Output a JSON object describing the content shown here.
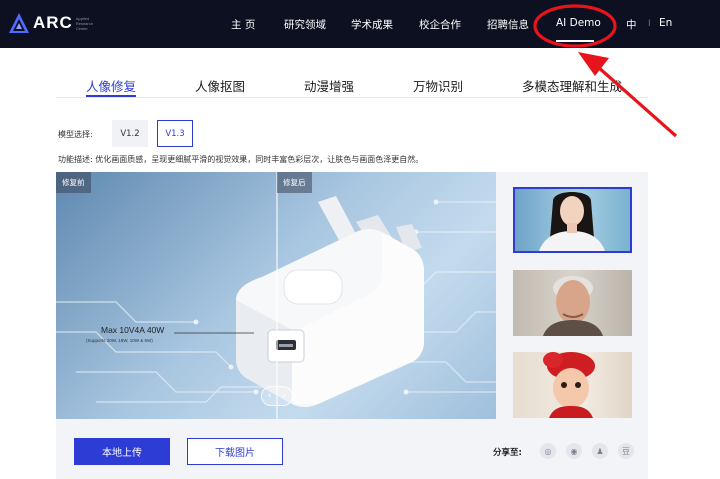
{
  "brand": {
    "name": "ARC",
    "sub": "Applied Research Center"
  },
  "nav": {
    "items": [
      "主 页",
      "研究领域",
      "学术成果",
      "校企合作",
      "招聘信息",
      "AI Demo"
    ],
    "lang_zh": "中",
    "lang_sep": "I",
    "lang_en": "En"
  },
  "tabs": [
    "人像修复",
    "人像抠图",
    "动漫增强",
    "万物识别",
    "多模态理解和生成"
  ],
  "model": {
    "label": "模型选择:",
    "options": [
      "V1.2",
      "V1.3"
    ],
    "selected": "V1.3"
  },
  "description": "功能描述:   优化画面质感，呈现更细腻平滑的视觉效果，同时丰富色彩层次，让肤色与画面色泽更自然。",
  "viewer": {
    "before_tag": "修复前",
    "after_tag": "修复后",
    "product_label": "Max 10V4A 40W",
    "product_sub": "(Supports 20W, 18W, 10W & 5W)",
    "handle_left": "‹",
    "handle_right": "›"
  },
  "actions": {
    "upload": "本地上传",
    "download": "下载图片",
    "share_label": "分享至:"
  },
  "share_icons": [
    "wechat-icon",
    "weibo-icon",
    "qq-icon",
    "douban-icon"
  ],
  "share_glyphs": [
    "◎",
    "◉",
    "♟",
    "豆"
  ],
  "colors": {
    "nav_bg": "#0d1021",
    "accent": "#2e3cd6",
    "annotation": "#e8141c"
  }
}
